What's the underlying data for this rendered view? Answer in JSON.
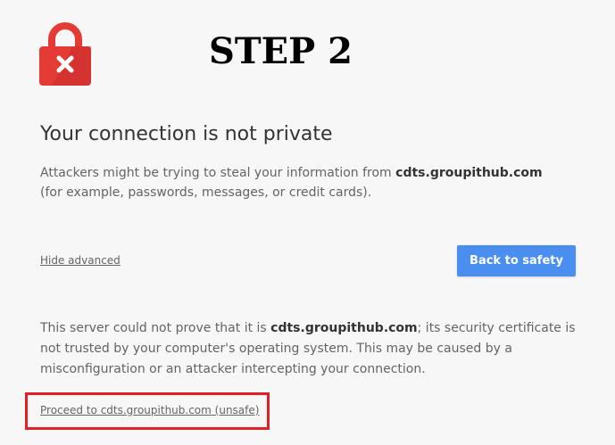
{
  "step_label": "STEP 2",
  "heading": "Your connection is not private",
  "intro": {
    "before": "Attackers might be trying to steal your information from ",
    "domain": "cdts.groupithub.com",
    "after": " (for example, passwords, messages, or credit cards)."
  },
  "hide_advanced_label": "Hide advanced",
  "back_button_label": "Back to safety",
  "details": {
    "before": "This server could not prove that it is ",
    "domain": "cdts.groupithub.com",
    "after": "; its security certificate is not trusted by your computer's operating system. This may be caused by a misconfiguration or an attacker intercepting your connection."
  },
  "proceed_link_label": "Proceed to cdts.groupithub.com (unsafe)",
  "icons": {
    "lock": "lock-error-icon"
  },
  "colors": {
    "accent_button": "#4a8ff0",
    "lock_red": "#e53b35",
    "highlight_border": "#e01f26"
  }
}
